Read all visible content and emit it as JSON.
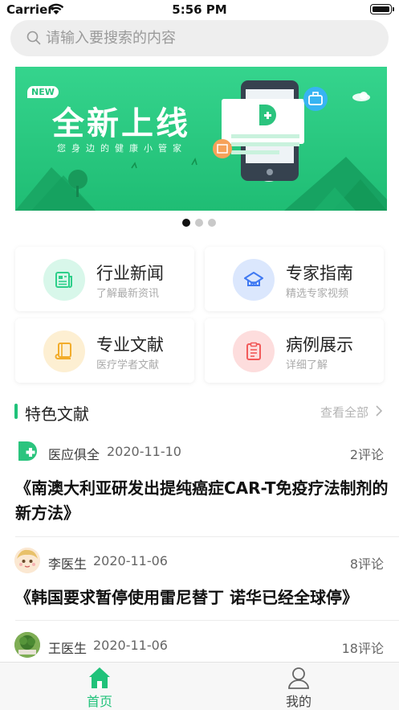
{
  "status_bar": {
    "carrier": "Carrier",
    "time": "5:56 PM"
  },
  "search": {
    "placeholder": "请输入要搜索的内容",
    "value": ""
  },
  "banner": {
    "badge": "NEW",
    "title": "全新上线",
    "subtitle": "您身边的健康小管家"
  },
  "pager": {
    "count": 3,
    "active": 0
  },
  "quick_links": [
    {
      "title": "行业新闻",
      "subtitle": "了解最新资讯",
      "icon": "newspaper-icon",
      "color": "#2ecf8a",
      "bg": "#d8f7ea"
    },
    {
      "title": "专家指南",
      "subtitle": "精选专家视频",
      "icon": "graduation-cap-icon",
      "color": "#3f79f2",
      "bg": "#dbe7fd"
    },
    {
      "title": "专业文献",
      "subtitle": "医疗学者文献",
      "icon": "book-icon",
      "color": "#f2ac2b",
      "bg": "#fdefd2"
    },
    {
      "title": "病例展示",
      "subtitle": "详细了解",
      "icon": "clipboard-icon",
      "color": "#f25a5a",
      "bg": "#fddddd"
    }
  ],
  "section": {
    "title": "特色文献",
    "see_all": "查看全部"
  },
  "articles": [
    {
      "author": "医应俱全",
      "date": "2020-11-10",
      "comments": "2评论",
      "title": "《南澳大利亚研发出提纯癌症CAR-T免疫疗法制剂的新方法》"
    },
    {
      "author": "李医生",
      "date": "2020-11-06",
      "comments": "8评论",
      "title": "《韩国要求暂停使用雷尼替丁 诺华已经全球停》"
    },
    {
      "author": "王医生",
      "date": "2020-11-06",
      "comments": "18评论",
      "title": ""
    }
  ],
  "tabs": [
    {
      "label": "首页",
      "icon": "home-icon",
      "active": true
    },
    {
      "label": "我的",
      "icon": "user-icon",
      "active": false
    }
  ],
  "colors": {
    "accent": "#20c27a",
    "tab_inactive": "#555555"
  }
}
